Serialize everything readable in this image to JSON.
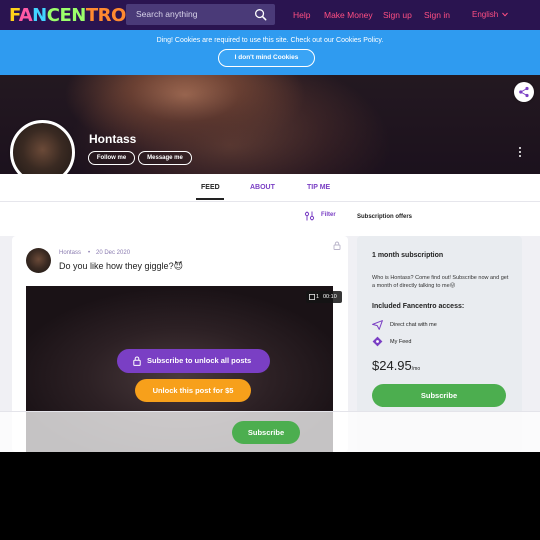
{
  "header": {
    "logo_parts": [
      "F",
      "A",
      "N",
      "CEN",
      "TRO"
    ],
    "search_placeholder": "Search anything",
    "nav": [
      "Help",
      "Make Money",
      "Sign up",
      "Sign in"
    ],
    "language": "English"
  },
  "cookie_bar": {
    "message": "Ding! Cookies are required to use this site. Check out our Cookies Policy.",
    "button": "I don't mind Cookies"
  },
  "profile": {
    "name": "Hontass",
    "follow_label": "Follow me",
    "message_label": "Message me"
  },
  "tabs": [
    "FEED",
    "ABOUT",
    "TIP ME"
  ],
  "feed_toolbar": {
    "filter_label": "Filter",
    "subscription_offers": "Subscription offers"
  },
  "post": {
    "author": "Hontass",
    "bullet": "•",
    "date": "20 Dec 2020",
    "text": "Do you like how they giggle?😈",
    "media_count": "1",
    "media_duration": "00:10",
    "unlock_all_label": "Subscribe to unlock all posts",
    "unlock_one_label": "Unlock this post for $5"
  },
  "subscription": {
    "title": "1 month subscription",
    "description": "Who is Hontass? Come find out! Subscribe now and get a month of directly talking to me😜",
    "included_title": "Included Fancentro access:",
    "features": [
      "Direct chat with me",
      "My Feed"
    ],
    "price": "$24.95",
    "per": "/mo",
    "subscribe_label": "Subscribe"
  },
  "sticky_bar": {
    "subscribe_label": "Subscribe"
  },
  "colors": {
    "nav_bg": "#2a1450",
    "nav_link": "#ff4f83",
    "cookie_bg": "#2f9bf0",
    "accent_purple": "#7a3fc4",
    "accent_orange": "#f7a01b",
    "accent_green": "#4cae4f"
  }
}
